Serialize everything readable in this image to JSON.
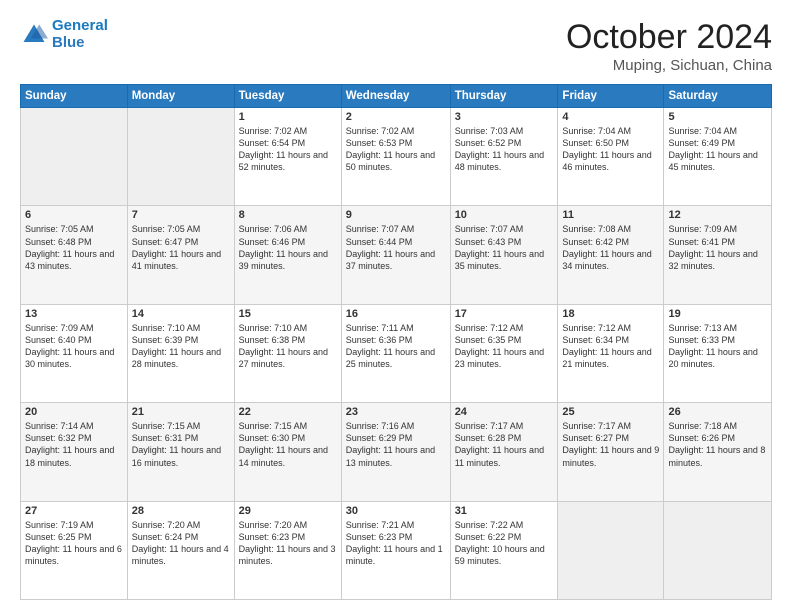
{
  "header": {
    "logo_line1": "General",
    "logo_line2": "Blue",
    "title": "October 2024",
    "subtitle": "Muping, Sichuan, China"
  },
  "days_of_week": [
    "Sunday",
    "Monday",
    "Tuesday",
    "Wednesday",
    "Thursday",
    "Friday",
    "Saturday"
  ],
  "weeks": [
    [
      {
        "num": "",
        "sunrise": "",
        "sunset": "",
        "daylight": ""
      },
      {
        "num": "",
        "sunrise": "",
        "sunset": "",
        "daylight": ""
      },
      {
        "num": "1",
        "sunrise": "Sunrise: 7:02 AM",
        "sunset": "Sunset: 6:54 PM",
        "daylight": "Daylight: 11 hours and 52 minutes."
      },
      {
        "num": "2",
        "sunrise": "Sunrise: 7:02 AM",
        "sunset": "Sunset: 6:53 PM",
        "daylight": "Daylight: 11 hours and 50 minutes."
      },
      {
        "num": "3",
        "sunrise": "Sunrise: 7:03 AM",
        "sunset": "Sunset: 6:52 PM",
        "daylight": "Daylight: 11 hours and 48 minutes."
      },
      {
        "num": "4",
        "sunrise": "Sunrise: 7:04 AM",
        "sunset": "Sunset: 6:50 PM",
        "daylight": "Daylight: 11 hours and 46 minutes."
      },
      {
        "num": "5",
        "sunrise": "Sunrise: 7:04 AM",
        "sunset": "Sunset: 6:49 PM",
        "daylight": "Daylight: 11 hours and 45 minutes."
      }
    ],
    [
      {
        "num": "6",
        "sunrise": "Sunrise: 7:05 AM",
        "sunset": "Sunset: 6:48 PM",
        "daylight": "Daylight: 11 hours and 43 minutes."
      },
      {
        "num": "7",
        "sunrise": "Sunrise: 7:05 AM",
        "sunset": "Sunset: 6:47 PM",
        "daylight": "Daylight: 11 hours and 41 minutes."
      },
      {
        "num": "8",
        "sunrise": "Sunrise: 7:06 AM",
        "sunset": "Sunset: 6:46 PM",
        "daylight": "Daylight: 11 hours and 39 minutes."
      },
      {
        "num": "9",
        "sunrise": "Sunrise: 7:07 AM",
        "sunset": "Sunset: 6:44 PM",
        "daylight": "Daylight: 11 hours and 37 minutes."
      },
      {
        "num": "10",
        "sunrise": "Sunrise: 7:07 AM",
        "sunset": "Sunset: 6:43 PM",
        "daylight": "Daylight: 11 hours and 35 minutes."
      },
      {
        "num": "11",
        "sunrise": "Sunrise: 7:08 AM",
        "sunset": "Sunset: 6:42 PM",
        "daylight": "Daylight: 11 hours and 34 minutes."
      },
      {
        "num": "12",
        "sunrise": "Sunrise: 7:09 AM",
        "sunset": "Sunset: 6:41 PM",
        "daylight": "Daylight: 11 hours and 32 minutes."
      }
    ],
    [
      {
        "num": "13",
        "sunrise": "Sunrise: 7:09 AM",
        "sunset": "Sunset: 6:40 PM",
        "daylight": "Daylight: 11 hours and 30 minutes."
      },
      {
        "num": "14",
        "sunrise": "Sunrise: 7:10 AM",
        "sunset": "Sunset: 6:39 PM",
        "daylight": "Daylight: 11 hours and 28 minutes."
      },
      {
        "num": "15",
        "sunrise": "Sunrise: 7:10 AM",
        "sunset": "Sunset: 6:38 PM",
        "daylight": "Daylight: 11 hours and 27 minutes."
      },
      {
        "num": "16",
        "sunrise": "Sunrise: 7:11 AM",
        "sunset": "Sunset: 6:36 PM",
        "daylight": "Daylight: 11 hours and 25 minutes."
      },
      {
        "num": "17",
        "sunrise": "Sunrise: 7:12 AM",
        "sunset": "Sunset: 6:35 PM",
        "daylight": "Daylight: 11 hours and 23 minutes."
      },
      {
        "num": "18",
        "sunrise": "Sunrise: 7:12 AM",
        "sunset": "Sunset: 6:34 PM",
        "daylight": "Daylight: 11 hours and 21 minutes."
      },
      {
        "num": "19",
        "sunrise": "Sunrise: 7:13 AM",
        "sunset": "Sunset: 6:33 PM",
        "daylight": "Daylight: 11 hours and 20 minutes."
      }
    ],
    [
      {
        "num": "20",
        "sunrise": "Sunrise: 7:14 AM",
        "sunset": "Sunset: 6:32 PM",
        "daylight": "Daylight: 11 hours and 18 minutes."
      },
      {
        "num": "21",
        "sunrise": "Sunrise: 7:15 AM",
        "sunset": "Sunset: 6:31 PM",
        "daylight": "Daylight: 11 hours and 16 minutes."
      },
      {
        "num": "22",
        "sunrise": "Sunrise: 7:15 AM",
        "sunset": "Sunset: 6:30 PM",
        "daylight": "Daylight: 11 hours and 14 minutes."
      },
      {
        "num": "23",
        "sunrise": "Sunrise: 7:16 AM",
        "sunset": "Sunset: 6:29 PM",
        "daylight": "Daylight: 11 hours and 13 minutes."
      },
      {
        "num": "24",
        "sunrise": "Sunrise: 7:17 AM",
        "sunset": "Sunset: 6:28 PM",
        "daylight": "Daylight: 11 hours and 11 minutes."
      },
      {
        "num": "25",
        "sunrise": "Sunrise: 7:17 AM",
        "sunset": "Sunset: 6:27 PM",
        "daylight": "Daylight: 11 hours and 9 minutes."
      },
      {
        "num": "26",
        "sunrise": "Sunrise: 7:18 AM",
        "sunset": "Sunset: 6:26 PM",
        "daylight": "Daylight: 11 hours and 8 minutes."
      }
    ],
    [
      {
        "num": "27",
        "sunrise": "Sunrise: 7:19 AM",
        "sunset": "Sunset: 6:25 PM",
        "daylight": "Daylight: 11 hours and 6 minutes."
      },
      {
        "num": "28",
        "sunrise": "Sunrise: 7:20 AM",
        "sunset": "Sunset: 6:24 PM",
        "daylight": "Daylight: 11 hours and 4 minutes."
      },
      {
        "num": "29",
        "sunrise": "Sunrise: 7:20 AM",
        "sunset": "Sunset: 6:23 PM",
        "daylight": "Daylight: 11 hours and 3 minutes."
      },
      {
        "num": "30",
        "sunrise": "Sunrise: 7:21 AM",
        "sunset": "Sunset: 6:23 PM",
        "daylight": "Daylight: 11 hours and 1 minute."
      },
      {
        "num": "31",
        "sunrise": "Sunrise: 7:22 AM",
        "sunset": "Sunset: 6:22 PM",
        "daylight": "Daylight: 10 hours and 59 minutes."
      },
      {
        "num": "",
        "sunrise": "",
        "sunset": "",
        "daylight": ""
      },
      {
        "num": "",
        "sunrise": "",
        "sunset": "",
        "daylight": ""
      }
    ]
  ]
}
